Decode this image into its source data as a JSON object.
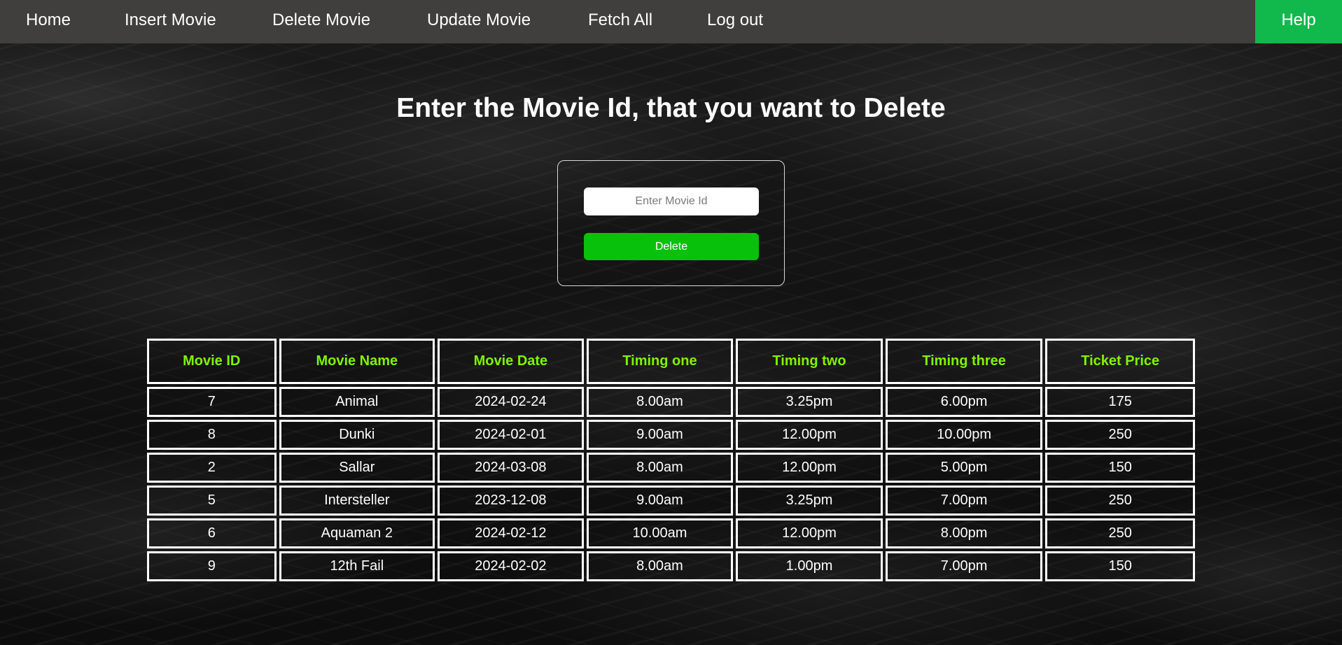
{
  "nav": {
    "items": [
      {
        "label": "Home"
      },
      {
        "label": "Insert Movie"
      },
      {
        "label": "Delete Movie"
      },
      {
        "label": "Update Movie"
      },
      {
        "label": "Fetch All"
      },
      {
        "label": "Log out"
      }
    ],
    "help_label": "Help"
  },
  "main": {
    "title": "Enter the Movie Id, that you want to Delete",
    "form": {
      "input_placeholder": "Enter Movie Id",
      "input_value": "",
      "delete_label": "Delete"
    }
  },
  "table": {
    "headers": [
      "Movie ID",
      "Movie Name",
      "Movie Date",
      "Timing one",
      "Timing two",
      "Timing three",
      "Ticket Price"
    ],
    "rows": [
      [
        "7",
        "Animal",
        "2024-02-24",
        "8.00am",
        "3.25pm",
        "6.00pm",
        "175"
      ],
      [
        "8",
        "Dunki",
        "2024-02-01",
        "9.00am",
        "12.00pm",
        "10.00pm",
        "250"
      ],
      [
        "2",
        "Sallar",
        "2024-03-08",
        "8.00am",
        "12.00pm",
        "5.00pm",
        "150"
      ],
      [
        "5",
        "Intersteller",
        "2023-12-08",
        "9.00am",
        "3.25pm",
        "7.00pm",
        "250"
      ],
      [
        "6",
        "Aquaman 2",
        "2024-02-12",
        "10.00am",
        "12.00pm",
        "8.00pm",
        "250"
      ],
      [
        "9",
        "12th Fail",
        "2024-02-02",
        "8.00am",
        "1.00pm",
        "7.00pm",
        "150"
      ]
    ]
  },
  "colors": {
    "navbar": "#413e3e",
    "help_button": "#11b84c",
    "delete_button": "#08c10b",
    "table_header_text": "#80f400"
  }
}
